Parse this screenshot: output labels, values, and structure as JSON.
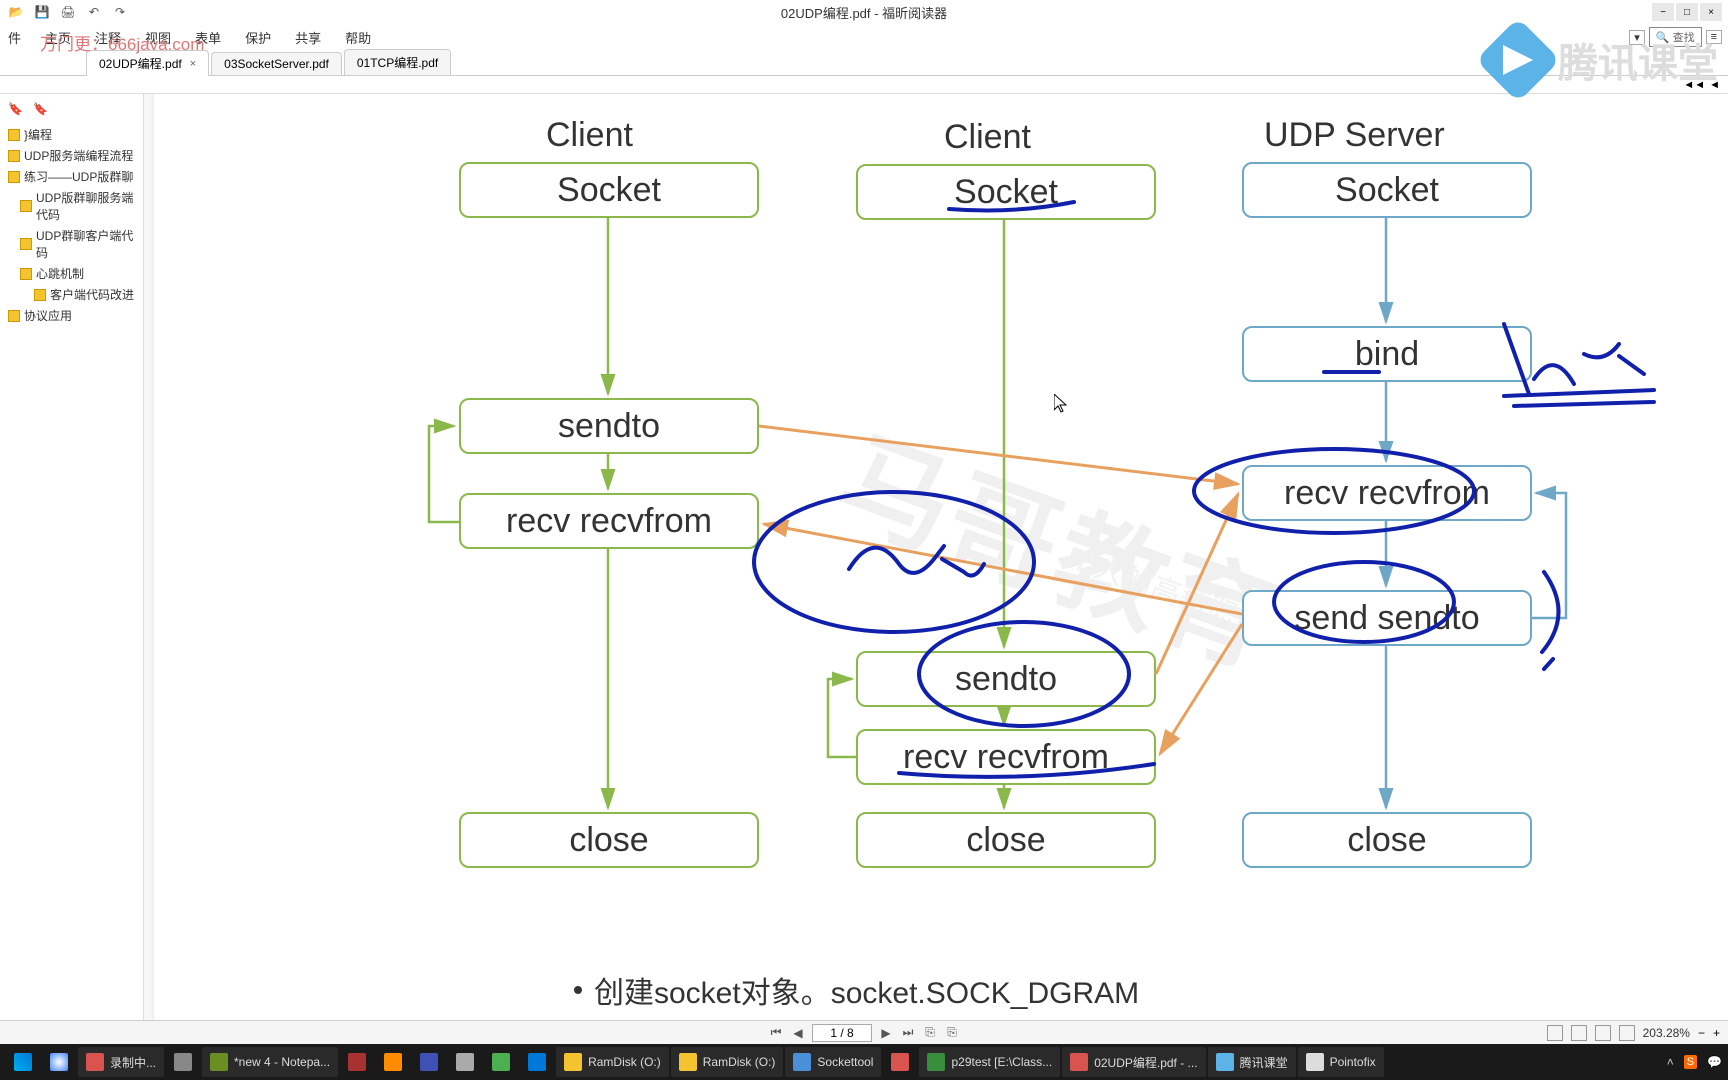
{
  "titlebar": {
    "title": "02UDP编程.pdf - 福昕阅读器"
  },
  "menubar": {
    "items": [
      "件",
      "主页",
      "注释",
      "视图",
      "表单",
      "保护",
      "共享",
      "帮助"
    ],
    "right": {
      "search": "🔍 查找"
    }
  },
  "watermark": {
    "text": "万门更：666java.com",
    "logo": "腾讯课堂"
  },
  "tabs": [
    {
      "label": "02UDP编程.pdf",
      "active": true
    },
    {
      "label": "03SocketServer.pdf",
      "active": false
    },
    {
      "label": "01TCP编程.pdf",
      "active": false
    }
  ],
  "sidebar": {
    "tree": [
      {
        "label": "}编程",
        "indent": 0
      },
      {
        "label": "UDP服务端编程流程",
        "indent": 0
      },
      {
        "label": "练习——UDP版群聊",
        "indent": 0
      },
      {
        "label": "UDP版群聊服务端代码",
        "indent": 1
      },
      {
        "label": "UDP群聊客户端代码",
        "indent": 1
      },
      {
        "label": "心跳机制",
        "indent": 1
      },
      {
        "label": "客户端代码改进",
        "indent": 2
      },
      {
        "label": "协议应用",
        "indent": 0
      }
    ]
  },
  "diagram": {
    "col1_title": "Client",
    "col2_title": "Client",
    "col3_title": "UDP Server",
    "boxes": {
      "c1_socket": "Socket",
      "c1_sendto": "sendto",
      "c1_recv": "recv recvfrom",
      "c1_close": "close",
      "c2_socket": "Socket",
      "c2_sendto": "sendto",
      "c2_recv": "recv recvfrom",
      "c2_close": "close",
      "s_socket": "Socket",
      "s_bind": "bind",
      "s_recv": "recv recvfrom",
      "s_send": "send sendto",
      "s_close": "close"
    },
    "footer": "创建socket对象。socket.SOCK_DGRAM"
  },
  "bg_watermark": {
    "main": "马哥教育",
    "sub": "/\\人的高薪职业学"
  },
  "statusbar": {
    "page": "1 / 8",
    "zoom": "203.28%"
  },
  "taskbar": {
    "items": [
      {
        "label": "",
        "color": "#0078d7"
      },
      {
        "label": "",
        "color": "#4285f4"
      },
      {
        "label": "录制中...",
        "color": "#d9534f"
      },
      {
        "label": "",
        "color": "#888"
      },
      {
        "label": "*new 4 - Notepa...",
        "color": "#6b8e23"
      },
      {
        "label": "",
        "color": "#a83232"
      },
      {
        "label": "",
        "color": "#ff8c00"
      },
      {
        "label": "",
        "color": "#3f51b5"
      },
      {
        "label": "",
        "color": "#aaa"
      },
      {
        "label": "",
        "color": "#4caf50"
      },
      {
        "label": "",
        "color": "#0078d7"
      },
      {
        "label": "RamDisk (O:)",
        "color": "#f4c430"
      },
      {
        "label": "RamDisk (O:)",
        "color": "#f4c430"
      },
      {
        "label": "Sockettool",
        "color": "#4a90d9"
      },
      {
        "label": "",
        "color": "#d9534f"
      },
      {
        "label": "p29test [E:\\Class...",
        "color": "#388e3c"
      },
      {
        "label": "02UDP编程.pdf - ...",
        "color": "#d9534f"
      },
      {
        "label": "腾讯课堂",
        "color": "#5bb3e8"
      },
      {
        "label": "Pointofix",
        "color": "#ddd"
      }
    ],
    "tray": {
      "time": ""
    }
  }
}
